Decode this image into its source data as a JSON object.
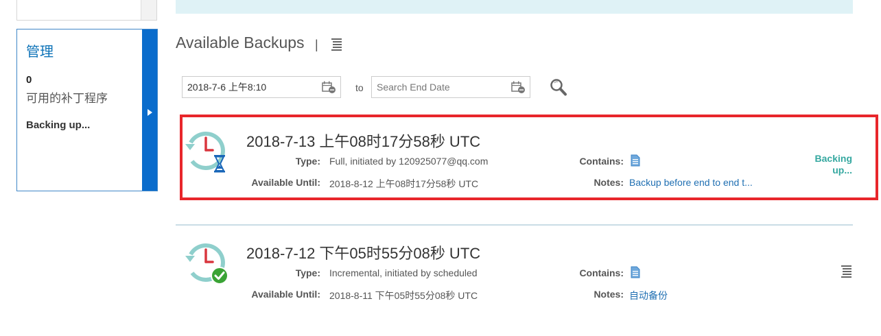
{
  "sidebar": {
    "management_card": {
      "title": "管理",
      "count": "0",
      "label": "可用的补丁程序",
      "status": "Backing up..."
    }
  },
  "header": {
    "title": "Available Backups",
    "separator": "|"
  },
  "filters": {
    "start_date_value": "2018-7-6 上午8:10",
    "end_date_placeholder": "Search End Date",
    "to_label": "to"
  },
  "labels": {
    "type": "Type:",
    "available_until": "Available Until:",
    "contains": "Contains:",
    "notes": "Notes:"
  },
  "backups": [
    {
      "date": "2018-7-13 上午08时17分58秒 UTC",
      "type": "Full, initiated by 120925077@qq.com",
      "available_until": "2018-8-12 上午08时17分58秒 UTC",
      "notes": "Backup before end to end t...",
      "status": "Backing up...",
      "state": "in-progress"
    },
    {
      "date": "2018-7-12 下午05时55分08秒 UTC",
      "type": "Incremental, initiated by scheduled",
      "available_until": "2018-8-11 下午05时55分08秒 UTC",
      "notes": "自动备份",
      "state": "complete"
    }
  ],
  "colors": {
    "accent_blue": "#0a6ccc",
    "link_blue": "#1f6fb2",
    "highlight_red": "#e8262b",
    "status_teal": "#35a8a0",
    "success_green": "#3aa335",
    "clock_teal": "#8fcfcc",
    "clock_red": "#d9363e"
  }
}
